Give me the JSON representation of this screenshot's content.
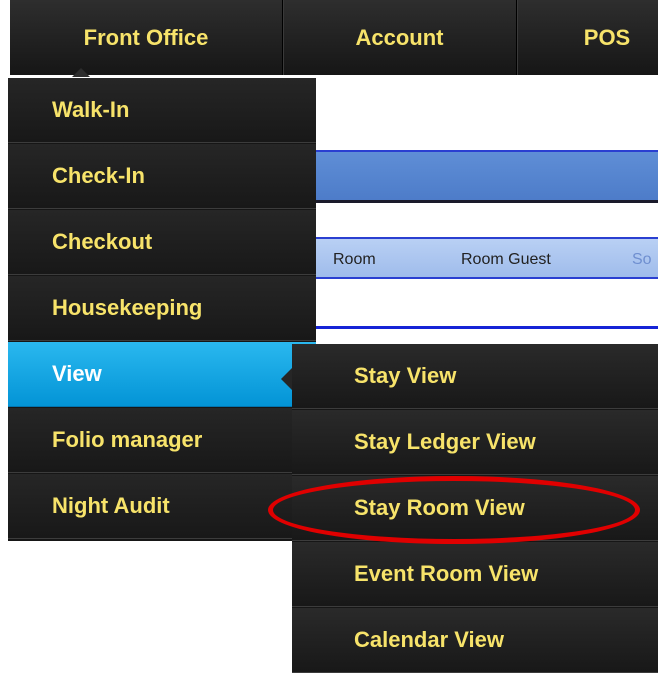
{
  "topnav": {
    "items": [
      {
        "label": "Front Office"
      },
      {
        "label": "Account"
      },
      {
        "label": "POS"
      }
    ]
  },
  "background": {
    "table_header": {
      "columns": [
        "Room",
        "Room Guest",
        "So"
      ]
    }
  },
  "front_office_menu": {
    "items": [
      {
        "label": "Walk-In"
      },
      {
        "label": "Check-In"
      },
      {
        "label": "Checkout"
      },
      {
        "label": "Housekeeping"
      },
      {
        "label": "View",
        "active": true
      },
      {
        "label": "Folio manager"
      },
      {
        "label": "Night Audit"
      }
    ]
  },
  "view_submenu": {
    "items": [
      {
        "label": "Stay View"
      },
      {
        "label": "Stay Ledger View"
      },
      {
        "label": "Stay Room View",
        "highlighted": true
      },
      {
        "label": "Event Room View"
      },
      {
        "label": "Calendar View"
      }
    ]
  },
  "colors": {
    "menu_text": "#f7e36a",
    "active_item": "#0394d6",
    "highlight_ring": "#e00000"
  }
}
